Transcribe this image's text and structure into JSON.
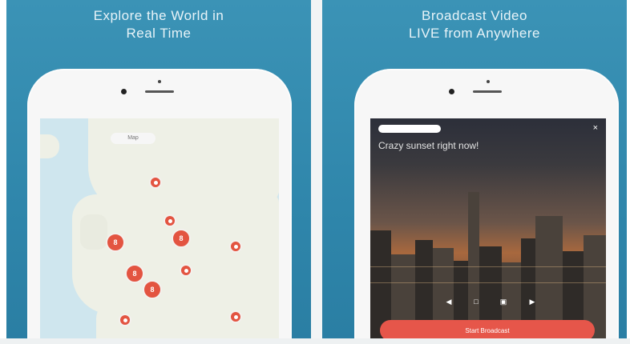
{
  "panels": [
    {
      "headline_line1": "Explore the World in",
      "headline_line2": "Real Time",
      "map": {
        "search_placeholder": "Map",
        "pin_labels": [
          "8",
          "8",
          "8",
          "8",
          "8"
        ]
      }
    },
    {
      "headline_line1": "Broadcast Video",
      "headline_line2": "LIVE from Anywhere",
      "broadcast": {
        "badge": "",
        "caption": "Crazy sunset right now!",
        "close": "×",
        "start_label": "Start Broadcast"
      }
    }
  ],
  "colors": {
    "panel_bg": "#2f86ab",
    "pin": "#e35441",
    "button": "#e6564a"
  }
}
